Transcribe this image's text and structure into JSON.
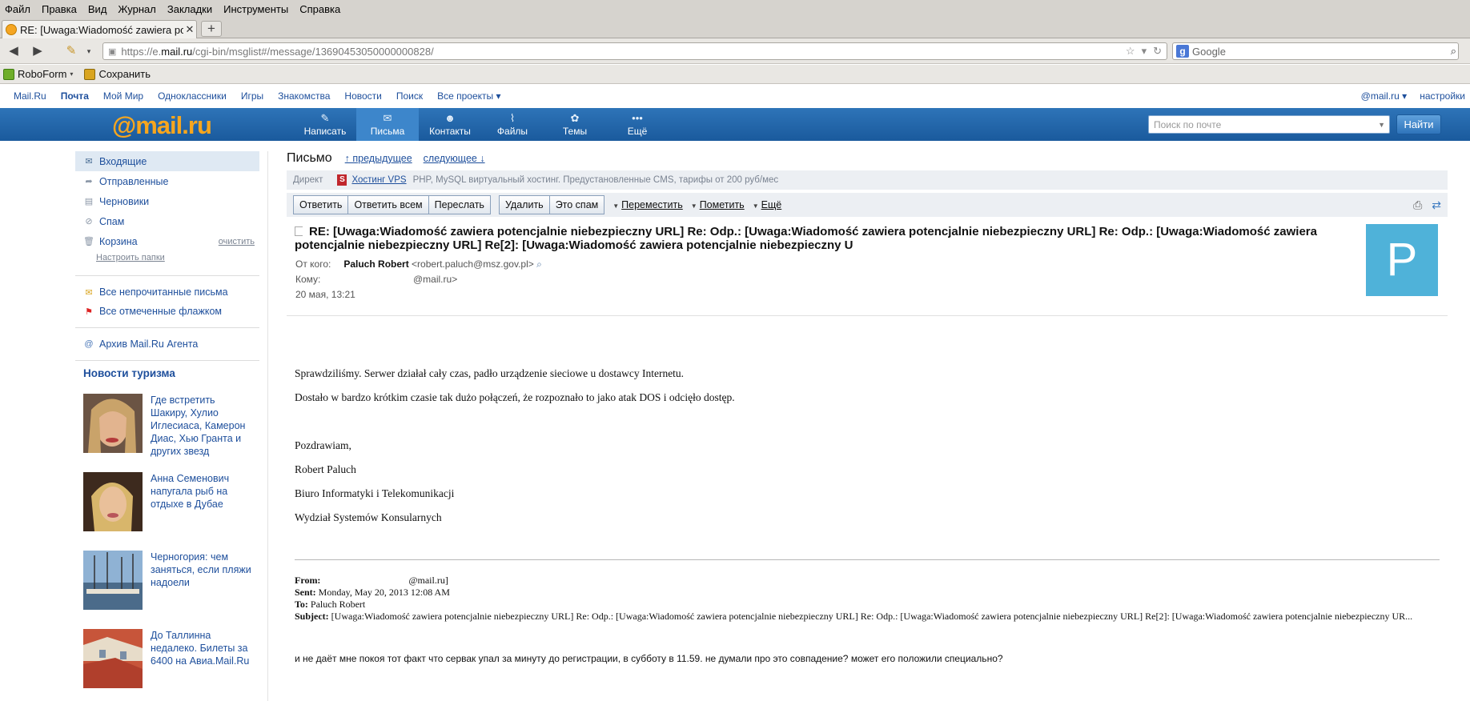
{
  "browser": {
    "menu": [
      "Файл",
      "Правка",
      "Вид",
      "Журнал",
      "Закладки",
      "Инструменты",
      "Справка"
    ],
    "tab_title": "RE: [Uwaga:Wiadomość zawiera pot...",
    "url_prefix": "https://e.",
    "url_domain": "mail.ru",
    "url_path": "/cgi-bin/msglist#/message/13690453050000000828/",
    "search_placeholder": "Google",
    "bookmarks": [
      "RoboForm",
      "Сохранить"
    ]
  },
  "portal": {
    "links": [
      "Mail.Ru",
      "Почта",
      "Мой Мир",
      "Одноклассники",
      "Игры",
      "Знакомства",
      "Новости",
      "Поиск",
      "Все проекты ▾"
    ],
    "account": "@mail.ru ▾",
    "settings": "настройки"
  },
  "header": {
    "logo_at": "@mail",
    "logo_dot": ".ru",
    "nav": [
      {
        "label": "Написать",
        "icon": "pencil-icon"
      },
      {
        "label": "Письма",
        "icon": "envelope-icon"
      },
      {
        "label": "Контакты",
        "icon": "contacts-icon"
      },
      {
        "label": "Файлы",
        "icon": "paperclip-icon"
      },
      {
        "label": "Темы",
        "icon": "themes-icon"
      },
      {
        "label": "Ещё",
        "icon": "more-icon"
      }
    ],
    "search_placeholder": "Поиск по почте",
    "find_button": "Найти"
  },
  "sidebar": {
    "folders": [
      "Входящие",
      "Отправленные",
      "Черновики",
      "Спам",
      "Корзина"
    ],
    "clean": "очистить",
    "setup_folders": "Настроить папки",
    "filters": [
      "Все непрочитанные письма",
      "Все отмеченные флажком"
    ],
    "archive": "Архив Mail.Ru Агента",
    "news_title": "Новости туризма",
    "news": [
      "Где встретить Шакиру, Хулио Иглесиаса, Камерон Диас, Хью Гранта и других звезд",
      "Анна Семенович напугала рыб на отдыхе в Дубае",
      "Черногория: чем заняться, если пляжи надоели",
      "До Таллинна недалеко. Билеты за 6400 на Авиа.Mail.Ru"
    ]
  },
  "message": {
    "heading": "Письмо",
    "prev": "↑ предыдущее",
    "next": "следующее ↓",
    "direct_label": "Директ",
    "direct_link": "Хостинг VPS",
    "direct_text": "PHP, MySQL виртуальный хостинг. Предустановленные CMS, тарифы от 200 руб/мес",
    "buttons_a": [
      "Ответить",
      "Ответить всем",
      "Переслать"
    ],
    "buttons_b": [
      "Удалить",
      "Это спам"
    ],
    "dropdowns": [
      "Переместить",
      "Пометить",
      "Ещё"
    ],
    "subject": "RE: [Uwaga:Wiadomość zawiera potencjalnie niebezpieczny URL] Re: Odp.: [Uwaga:Wiadomość zawiera potencjalnie niebezpieczny URL] Re: Odp.: [Uwaga:Wiadomość zawiera potencjalnie niebezpieczny URL] Re[2]: [Uwaga:Wiadomość zawiera potencjalnie niebezpieczny U",
    "from_label": "От кого:",
    "from_name": "Paluch Robert",
    "from_email": "<robert.paluch@msz.gov.pl>",
    "to_label": "Кому:",
    "to_value": "@mail.ru>",
    "date": "20 мая, 13:21",
    "avatar_letter": "P",
    "body": [
      "Sprawdziliśmy.  Serwer działał cały czas, padło urządzenie sieciowe u dostawcy Internetu.",
      "Dostało w bardzo krótkim czasie tak dużo połączeń, że rozpoznało to jako atak DOS i odcięło dostęp."
    ],
    "signature": [
      "Pozdrawiam,",
      "Robert Paluch",
      "Biuro Informatyki i Telekomunikacji",
      "Wydział Systemów Konsularnych"
    ],
    "fw_from_label": "From:",
    "fw_from": "@mail.ru]",
    "fw_sent_label": "Sent:",
    "fw_sent": "Monday, May 20, 2013 12:08 AM",
    "fw_to_label": "To:",
    "fw_to": "Paluch Robert",
    "fw_subject_label": "Subject:",
    "fw_subject": "[Uwaga:Wiadomość zawiera potencjalnie niebezpieczny URL] Re: Odp.: [Uwaga:Wiadomość zawiera potencjalnie niebezpieczny URL] Re: Odp.: [Uwaga:Wiadomość zawiera potencjalnie niebezpieczny URL] Re[2]: [Uwaga:Wiadomość zawiera potencjalnie niebezpieczny UR...",
    "last_line": "и не даёт мне покоя тот факт что сервак упал за минуту до регистрации, в субботу в 11.59. не думали про это совпадение? может его положили специально?"
  }
}
